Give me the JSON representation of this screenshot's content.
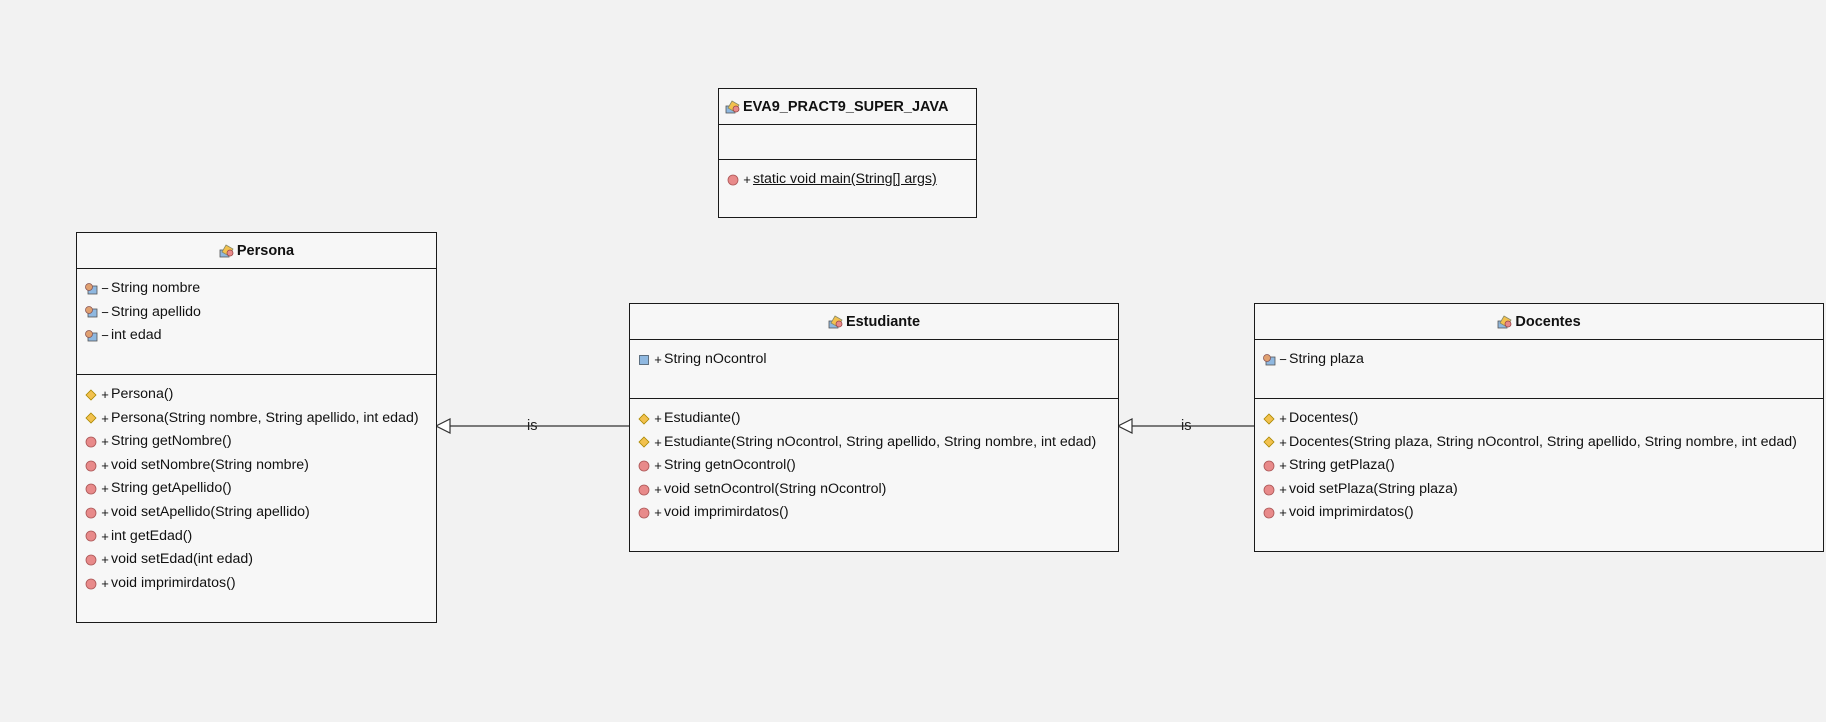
{
  "diagram": {
    "classes": {
      "main": {
        "name": "EVA9_PRACT9_SUPER_JAVA",
        "icon": "class-icon",
        "attributes": [],
        "operations": [
          {
            "visibility": "+",
            "text": "static void main(String[] args)",
            "icon": "method-icon",
            "static": true
          }
        ]
      },
      "persona": {
        "name": "Persona",
        "icon": "class-icon",
        "attributes": [
          {
            "visibility": "−",
            "text": "String nombre",
            "icon": "private-field-icon"
          },
          {
            "visibility": "−",
            "text": "String apellido",
            "icon": "private-field-icon"
          },
          {
            "visibility": "−",
            "text": "int edad",
            "icon": "private-field-icon"
          }
        ],
        "operations": [
          {
            "visibility": "+",
            "text": "Persona()",
            "icon": "constructor-icon"
          },
          {
            "visibility": "+",
            "text": "Persona(String nombre, String apellido, int edad)",
            "icon": "constructor-icon"
          },
          {
            "visibility": "+",
            "text": "String getNombre()",
            "icon": "method-icon"
          },
          {
            "visibility": "+",
            "text": "void setNombre(String nombre)",
            "icon": "method-icon"
          },
          {
            "visibility": "+",
            "text": "String getApellido()",
            "icon": "method-icon"
          },
          {
            "visibility": "+",
            "text": "void setApellido(String apellido)",
            "icon": "method-icon"
          },
          {
            "visibility": "+",
            "text": "int getEdad()",
            "icon": "method-icon"
          },
          {
            "visibility": "+",
            "text": "void setEdad(int edad)",
            "icon": "method-icon"
          },
          {
            "visibility": "+",
            "text": "void imprimirdatos()",
            "icon": "method-icon"
          }
        ]
      },
      "estudiante": {
        "name": "Estudiante",
        "icon": "class-icon",
        "attributes": [
          {
            "visibility": "+",
            "text": "String nOcontrol",
            "icon": "public-field-icon"
          }
        ],
        "operations": [
          {
            "visibility": "+",
            "text": "Estudiante()",
            "icon": "constructor-icon"
          },
          {
            "visibility": "+",
            "text": "Estudiante(String nOcontrol, String apellido, String nombre, int edad)",
            "icon": "constructor-icon"
          },
          {
            "visibility": "+",
            "text": "String getnOcontrol()",
            "icon": "method-icon"
          },
          {
            "visibility": "+",
            "text": "void setnOcontrol(String nOcontrol)",
            "icon": "method-icon"
          },
          {
            "visibility": "+",
            "text": "void imprimirdatos()",
            "icon": "method-icon"
          }
        ]
      },
      "docentes": {
        "name": "Docentes",
        "icon": "class-icon",
        "attributes": [
          {
            "visibility": "−",
            "text": "String plaza",
            "icon": "private-field-icon"
          }
        ],
        "operations": [
          {
            "visibility": "+",
            "text": "Docentes()",
            "icon": "constructor-icon"
          },
          {
            "visibility": "+",
            "text": "Docentes(String plaza, String nOcontrol, String apellido, String nombre, int edad)",
            "icon": "constructor-icon"
          },
          {
            "visibility": "+",
            "text": "String getPlaza()",
            "icon": "method-icon"
          },
          {
            "visibility": "+",
            "text": "void setPlaza(String plaza)",
            "icon": "method-icon"
          },
          {
            "visibility": "+",
            "text": "void imprimirdatos()",
            "icon": "method-icon"
          }
        ]
      }
    },
    "relations": [
      {
        "type": "generalization",
        "from": "Estudiante",
        "to": "Persona",
        "label": "is"
      },
      {
        "type": "generalization",
        "from": "Docentes",
        "to": "Estudiante",
        "label": "is"
      }
    ],
    "colors": {
      "background": "#f2f2f2",
      "box_fill": "#f7f7f7",
      "border": "#1a1a1a",
      "method_icon": "#e88a8a",
      "constructor_icon": "#f2c14e",
      "public_field_icon": "#8fb8e0"
    }
  }
}
